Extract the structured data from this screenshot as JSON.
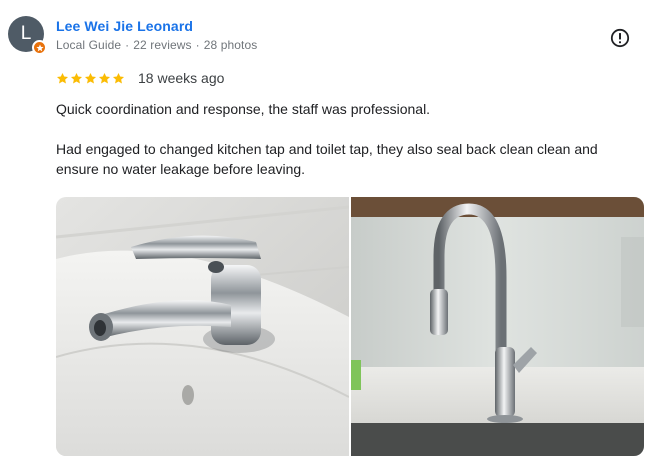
{
  "reviewer": {
    "initial": "L",
    "name": "Lee Wei Jie Leonard",
    "badge": "Local Guide",
    "reviews": "22 reviews",
    "photos": "28 photos",
    "separator": "·",
    "avatar_color": "#4f5b66",
    "badge_color": "#e8710a"
  },
  "review": {
    "rating": 5,
    "max_rating": 5,
    "date": "18 weeks ago",
    "paragraph_1": "Quick coordination and response, the staff was professional.",
    "paragraph_2": "Had engaged to changed kitchen tap and toilet tap, they also seal back clean clean and ensure no water leakage before leaving."
  },
  "icons": {
    "flag": "flag-report-icon",
    "star": "star-icon",
    "badge": "local-guide-star-icon"
  },
  "colors": {
    "name_link": "#1a73e8",
    "meta": "#70757a",
    "star": "#fbbc04"
  },
  "photos": [
    {
      "subject": "bathroom basin mixer tap"
    },
    {
      "subject": "kitchen pull-down mixer tap"
    }
  ]
}
